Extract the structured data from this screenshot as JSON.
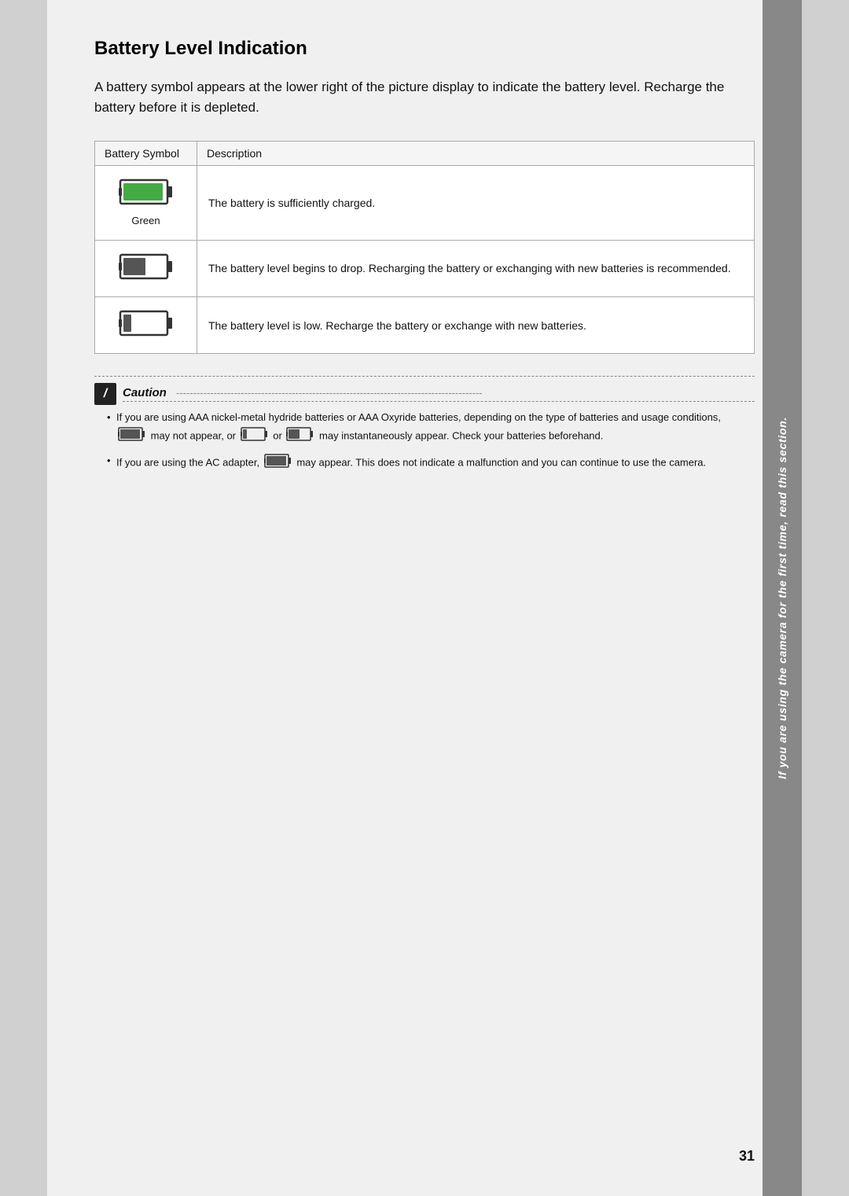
{
  "page": {
    "title": "Battery Level Indication",
    "intro": "A battery symbol appears at the lower right of the picture display to indicate the battery level. Recharge the battery before it is depleted.",
    "sidebar_text": "If you are using the camera for the first time, read this section.",
    "page_number": "31"
  },
  "table": {
    "col1_header": "Battery Symbol",
    "col2_header": "Description",
    "rows": [
      {
        "description": "The battery is sufficiently charged.",
        "label": "Green",
        "fill_level": "full"
      },
      {
        "description": "The battery level begins to drop. Recharging the battery or exchanging with new batteries is recommended.",
        "label": "",
        "fill_level": "half"
      },
      {
        "description": "The battery level is low. Recharge the battery or exchange with new batteries.",
        "label": "",
        "fill_level": "low"
      }
    ]
  },
  "caution": {
    "title": "Caution",
    "items": [
      "If you are using AAA nickel-metal hydride batteries or AAA Oxyride batteries, depending on the type of batteries and usage conditions,  may not appear, or  or  may instantaneously appear. Check your batteries beforehand.",
      "If you are using the AC adapter,  may appear. This does not indicate a malfunction and you can continue to use the camera."
    ]
  }
}
